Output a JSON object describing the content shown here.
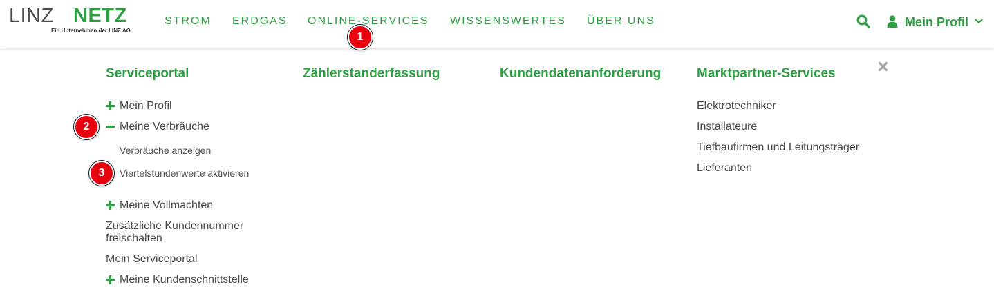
{
  "logo": {
    "linz": "LINZ",
    "netz": "NETZ",
    "tagline": "Ein Unternehmen der LINZ AG"
  },
  "nav": {
    "items": [
      {
        "label": "STROM"
      },
      {
        "label": "ERDGAS"
      },
      {
        "label": "ONLINE-SERVICES"
      },
      {
        "label": "WISSENSWERTES"
      },
      {
        "label": "ÜBER UNS"
      }
    ],
    "profile_label": "Mein Profil",
    "icons": [
      "search-icon",
      "user-icon",
      "chevron-down-icon"
    ]
  },
  "mega_menu": {
    "columns": [
      {
        "heading": "Serviceportal",
        "items": [
          {
            "label": "Mein Profil",
            "toggle": "plus"
          },
          {
            "label": "Meine Verbräuche",
            "toggle": "minus",
            "children": [
              {
                "label": "Verbräuche anzeigen"
              },
              {
                "label": "Viertelstundenwerte aktivieren"
              }
            ]
          },
          {
            "label": "Meine Vollmachten",
            "toggle": "plus"
          },
          {
            "label_line1": "Zusätzliche Kundennummer",
            "label_line2": "freischalten"
          },
          {
            "label": "Mein Serviceportal"
          },
          {
            "label": "Meine Kundenschnittstelle",
            "toggle": "plus"
          }
        ]
      },
      {
        "heading": "Zählerstanderfassung",
        "items": []
      },
      {
        "heading": "Kundendatenanforderung",
        "items": []
      },
      {
        "heading": "Marktpartner-Services",
        "items": [
          {
            "label": "Elektrotechniker"
          },
          {
            "label": "Installateure"
          },
          {
            "label": "Tiefbaufirmen und Leitungsträger"
          },
          {
            "label": "Lieferanten"
          }
        ]
      }
    ],
    "close_icon": "close-icon"
  },
  "annotations": [
    {
      "number": "1"
    },
    {
      "number": "2"
    },
    {
      "number": "3"
    }
  ],
  "colors": {
    "brand_green": "#2ea043",
    "text_gray": "#4a4a4a",
    "marker_red": "#e8000f"
  }
}
